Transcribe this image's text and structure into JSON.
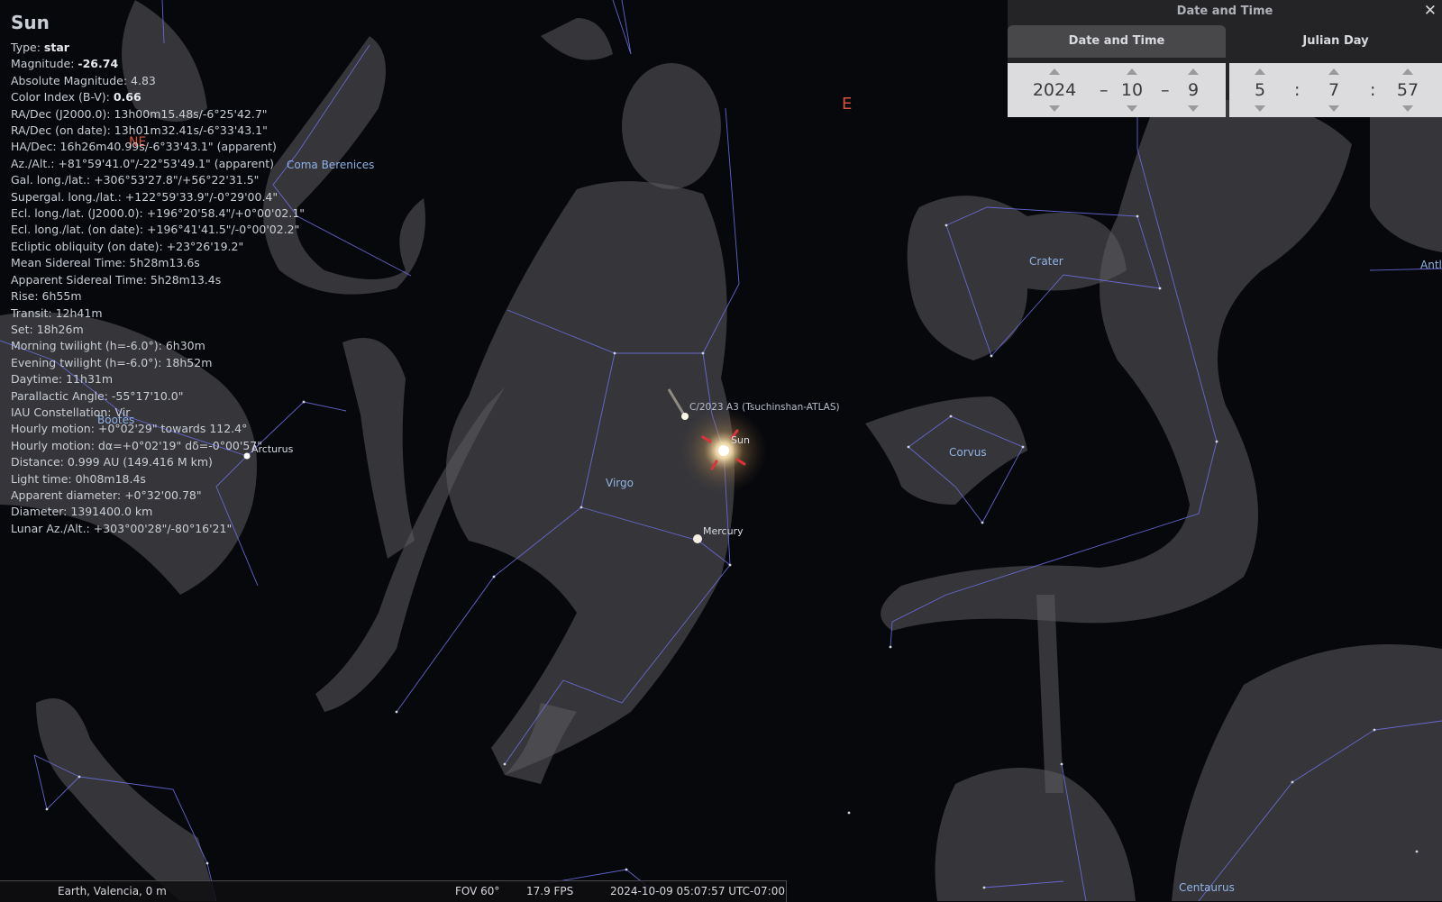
{
  "object_info": {
    "title": "Sun",
    "rows": [
      {
        "label": "Type: ",
        "value": "star",
        "bold": true
      },
      {
        "label": "Magnitude: ",
        "value": "-26.74",
        "bold": true
      },
      {
        "label": "Absolute Magnitude: ",
        "value": "4.83"
      },
      {
        "label": "Color Index (B-V): ",
        "value": "0.66",
        "bold": true
      },
      {
        "label": "RA/Dec (J2000.0): ",
        "value": "13h00m15.48s/-6°25'42.7\""
      },
      {
        "label": "RA/Dec (on date): ",
        "value": "13h01m32.41s/-6°33'43.1\""
      },
      {
        "label": "HA/Dec: ",
        "value": "16h26m40.99s/-6°33'43.1\" (apparent)"
      },
      {
        "label": "Az./Alt.: ",
        "value": "+81°59'41.0\"/-22°53'49.1\" (apparent)"
      },
      {
        "label": "Gal. long./lat.: ",
        "value": "+306°53'27.8\"/+56°22'31.5\""
      },
      {
        "label": "Supergal. long./lat.: ",
        "value": "+122°59'33.9\"/-0°29'00.4\""
      },
      {
        "label": "Ecl. long./lat. (J2000.0): ",
        "value": "+196°20'58.4\"/+0°00'02.1\""
      },
      {
        "label": "Ecl. long./lat. (on date): ",
        "value": "+196°41'41.5\"/-0°00'02.2\""
      },
      {
        "label": "Ecliptic obliquity (on date): ",
        "value": "+23°26'19.2\""
      },
      {
        "label": "Mean Sidereal Time: ",
        "value": "5h28m13.6s"
      },
      {
        "label": "Apparent Sidereal Time: ",
        "value": "5h28m13.4s"
      },
      {
        "label": "Rise: ",
        "value": "6h55m"
      },
      {
        "label": "Transit: ",
        "value": "12h41m"
      },
      {
        "label": "Set: ",
        "value": "18h26m"
      },
      {
        "label": "Morning twilight (h=-6.0°): ",
        "value": "6h30m"
      },
      {
        "label": "Evening twilight (h=-6.0°): ",
        "value": "18h52m"
      },
      {
        "label": "Daytime: ",
        "value": "11h31m"
      },
      {
        "label": "Parallactic Angle: ",
        "value": "-55°17'10.0\""
      },
      {
        "label": "IAU Constellation: ",
        "value": "Vir"
      },
      {
        "label": "Hourly motion: ",
        "value": "+0°02'29\" towards 112.4°"
      },
      {
        "label": "Hourly motion: ",
        "value": "dα=+0°02'19\" dδ=-0°00'57\""
      },
      {
        "label": "Distance: ",
        "value": "0.999 AU (149.416 M km)"
      },
      {
        "label": "Light time: ",
        "value": "0h08m18.4s"
      },
      {
        "label": "Apparent diameter: ",
        "value": "+0°32'00.78\""
      },
      {
        "label": "Diameter: ",
        "value": "1391400.0 km"
      },
      {
        "label": "Lunar Az./Alt.: ",
        "value": "+303°00'28\"/-80°16'21\""
      }
    ]
  },
  "sky_labels": {
    "coma": "Coma Berenices",
    "crater": "Crater",
    "bootes": "Bootes",
    "arcturus": "Arcturus",
    "comet": "C/2023 A3 (Tsuchinshan-ATLAS)",
    "sun": "Sun",
    "virgo": "Virgo",
    "mercury": "Mercury",
    "corvus": "Corvus",
    "antlia": "Antl",
    "centaurus": "Centaurus",
    "cardinal_e": "E",
    "cardinal_ne": "NE"
  },
  "dialog": {
    "title": "Date and Time",
    "close": "✕",
    "tab_date": "Date and Time",
    "tab_julian": "Julian Day",
    "year": "2024",
    "month": "10",
    "day": "9",
    "date_sep": "–",
    "hour": "5",
    "minute": "7",
    "second": "57",
    "time_sep": ":"
  },
  "status": {
    "location": "Earth, Valencia, 0 m",
    "fov": "FOV 60°",
    "fps": "17.9 FPS",
    "datetime": "2024-10-09 05:07:57 UTC-07:00"
  },
  "colors": {
    "constellation_line": "#6b6fe0",
    "constellation_label": "#8fb3e6",
    "cardinal": "#d4533b",
    "background": "#07080c"
  }
}
